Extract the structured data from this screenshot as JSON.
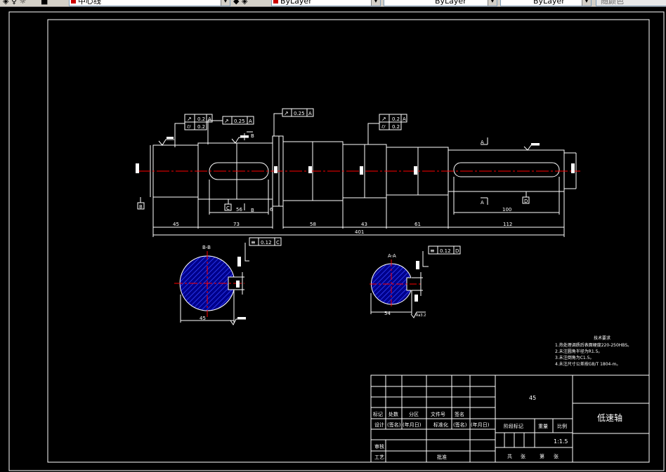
{
  "toolbar": {
    "linetype_value": "中心线",
    "layer_color_value": "ByLayer",
    "linetype_combo_value": "ByLayer",
    "lineweight_value": "ByLayer",
    "plotstyle_value": "随颜色"
  },
  "drawing": {
    "dims": {
      "d45": "45",
      "d73": "73",
      "d58": "58",
      "d43": "43",
      "d61": "61",
      "d112": "112",
      "d401": "401",
      "d100": "100",
      "d56": "56",
      "d6": "6",
      "d45_section": "45",
      "d54": "54",
      "ra32": "Ra3.2"
    },
    "tolerances": {
      "tol1_a": "0.2",
      "tol1_ref_a": "A",
      "tol1_b": "0.2",
      "tol2": "0.25",
      "tol2_ref": "A",
      "tol3": "0.25",
      "tol3_ref": "A",
      "tol4_a": "0.2",
      "tol4_ref_a": "A",
      "tol4_b": "0.2",
      "tol5": "0.12",
      "tol5_ref": "C",
      "tol6": "0.12",
      "tol6_ref": "D"
    },
    "datums": {
      "datum_b": "B",
      "datum_c": "C",
      "datum_d": "D",
      "section_a": "A",
      "section_b": "B"
    },
    "section_labels": {
      "bb": "B-B",
      "aa": "A-A"
    },
    "technical_requirements": {
      "title": "技术要求",
      "lines": [
        "1.热处理调质后表面硬度220-250HBS。",
        "2.未注圆角半径为R1.5。",
        "3.未注倒角为C1.5。",
        "4.未注尺寸公差按GB/T 1804-m。"
      ]
    },
    "title_block": {
      "material": "45",
      "part_name": "低速轴",
      "scale": "1:1.5",
      "headers_row1": [
        "标记",
        "处数",
        "分区",
        "文件号",
        "签名"
      ],
      "headers_row2": [
        "设计",
        "(签名)",
        "(年月日)",
        "标准化",
        "(签名)",
        "(年月日)"
      ],
      "stage_mark": "阶段标记",
      "weight": "重量",
      "ratio": "比例",
      "review": "审核",
      "process": "工艺",
      "approve": "批准",
      "total_sheets": "共",
      "sheet_unit": "张",
      "sheet_no": "第",
      "sheet_unit2": "张"
    }
  },
  "colors": {
    "background": "#000000",
    "line": "#ffffff",
    "centerline": "#ff0000",
    "hatch": "#0000ff",
    "toolbar": "#d4d0c8"
  }
}
